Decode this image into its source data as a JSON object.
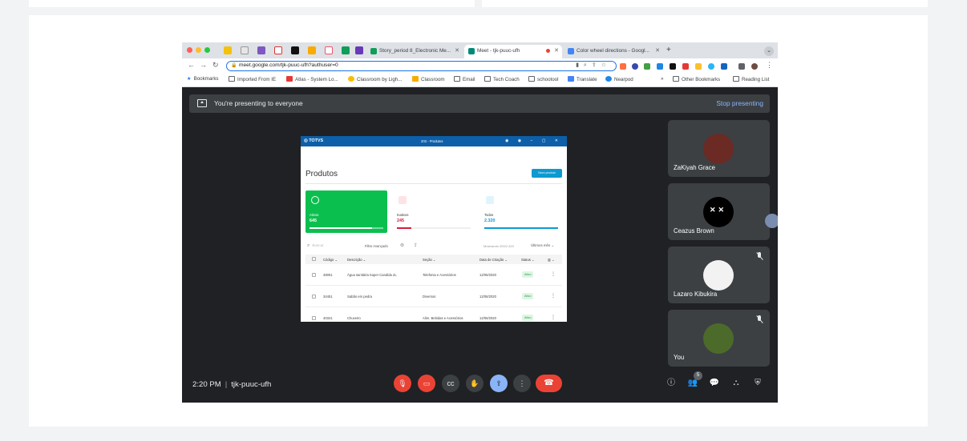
{
  "tabs": [
    {
      "label": "Story_period 8_Electronic Me..."
    },
    {
      "label": "Meet - tjk-puuc-ufh"
    },
    {
      "label": "Color wheel directions - Googl..."
    }
  ],
  "address": {
    "url": "meet.google.com/tjk-puuc-ufh?authuser=0"
  },
  "bookmarks": [
    "Bookmarks",
    "Imported From IE",
    "Atlas - System Lo...",
    "Classroom by Ligh...",
    "Classroom",
    "Email",
    "Tech Coach",
    "schootool",
    "Translate",
    "Nearpod"
  ],
  "bookmarks_right": [
    "Other Bookmarks",
    "Reading List"
  ],
  "banner": {
    "text": "You're presenting to everyone",
    "stop": "Stop presenting"
  },
  "shared": {
    "logo": "TOTVS",
    "window_title": "203 - Produtos",
    "page_title": "Produtos",
    "new_button": "Novo produto",
    "cards": [
      {
        "label": "Ativos",
        "value": "645",
        "fill": 0.85
      },
      {
        "label": "Inativos",
        "value": "245",
        "fill": 0.2
      },
      {
        "label": "Todos",
        "value": "2.320",
        "fill": 1.0
      }
    ],
    "search_placeholder": "Buscar",
    "filter": "Filtro Avançado",
    "count": "Mostrando 200/2.320",
    "recent": "Últimos mês",
    "columns": [
      "Código",
      "Descrição",
      "Seção",
      "Data de Criação",
      "Status"
    ],
    "rows": [
      {
        "code": "48051",
        "desc": "Água sanitária Super Candida 2L",
        "section": "Telefonia e Acessórios",
        "date": "12/06/2020",
        "status": "Ativo"
      },
      {
        "code": "34451",
        "desc": "Sabão em pedra",
        "section": "Diversos",
        "date": "12/06/2020",
        "status": "Ativo"
      },
      {
        "code": "40341",
        "desc": "Chuveiro",
        "section": "Alim. Bebidas e Acessórios",
        "date": "12/06/2020",
        "status": "Ativo"
      }
    ]
  },
  "participants": [
    {
      "name": "ZaKiyah Grace",
      "muted": false,
      "color": "#6b2a24"
    },
    {
      "name": "Ceazus Brown",
      "muted": false,
      "color": "#000000"
    },
    {
      "name": "Lazaro Kibukira",
      "muted": true,
      "color": "#f2f2f2"
    },
    {
      "name": "You",
      "muted": true,
      "color": "#4c6b2a"
    }
  ],
  "meeting": {
    "time": "2:20 PM",
    "code": "tjk-puuc-ufh",
    "participant_count": "5"
  },
  "colors": {
    "accent": "#1a73e8",
    "danger": "#ea4335",
    "meet_bg": "#202124",
    "tile_bg": "#3c4043"
  }
}
